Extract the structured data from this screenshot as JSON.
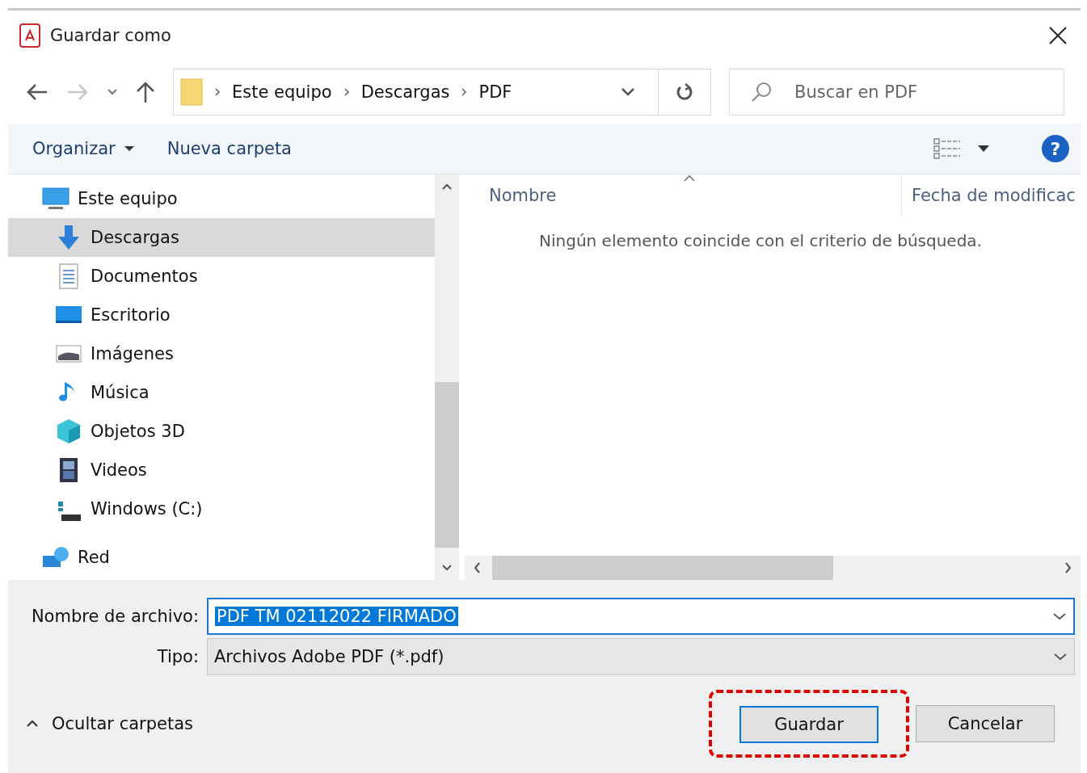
{
  "window": {
    "title": "Guardar como"
  },
  "address_bar": {
    "crumbs": [
      "Este equipo",
      "Descargas",
      "PDF"
    ]
  },
  "search": {
    "placeholder": "Buscar en PDF"
  },
  "toolbar": {
    "organize": "Organizar",
    "new_folder": "Nueva carpeta",
    "help": "?"
  },
  "sidebar": {
    "items": [
      {
        "label": "Este equipo",
        "selected": false,
        "children": [
          {
            "label": "Descargas",
            "selected": true
          },
          {
            "label": "Documentos",
            "selected": false
          },
          {
            "label": "Escritorio",
            "selected": false
          },
          {
            "label": "Imágenes",
            "selected": false
          },
          {
            "label": "Música",
            "selected": false
          },
          {
            "label": "Objetos 3D",
            "selected": false
          },
          {
            "label": "Videos",
            "selected": false
          },
          {
            "label": "Windows (C:)",
            "selected": false
          }
        ]
      },
      {
        "label": "Red",
        "selected": false
      }
    ]
  },
  "file_list": {
    "columns": [
      "Nombre",
      "Fecha de modificac"
    ],
    "empty_message": "Ningún elemento coincide con el criterio de búsqueda."
  },
  "form": {
    "filename_label": "Nombre de archivo:",
    "filename_value": "PDF TM 02112022 FIRMADO",
    "type_label": "Tipo:",
    "type_value": "Archivos Adobe PDF (*.pdf)"
  },
  "footer": {
    "hide_folders": "Ocultar carpetas",
    "buttons": [
      {
        "label": "Guardar",
        "kind": "primary"
      },
      {
        "label": "Cancelar",
        "kind": "normal"
      }
    ]
  }
}
